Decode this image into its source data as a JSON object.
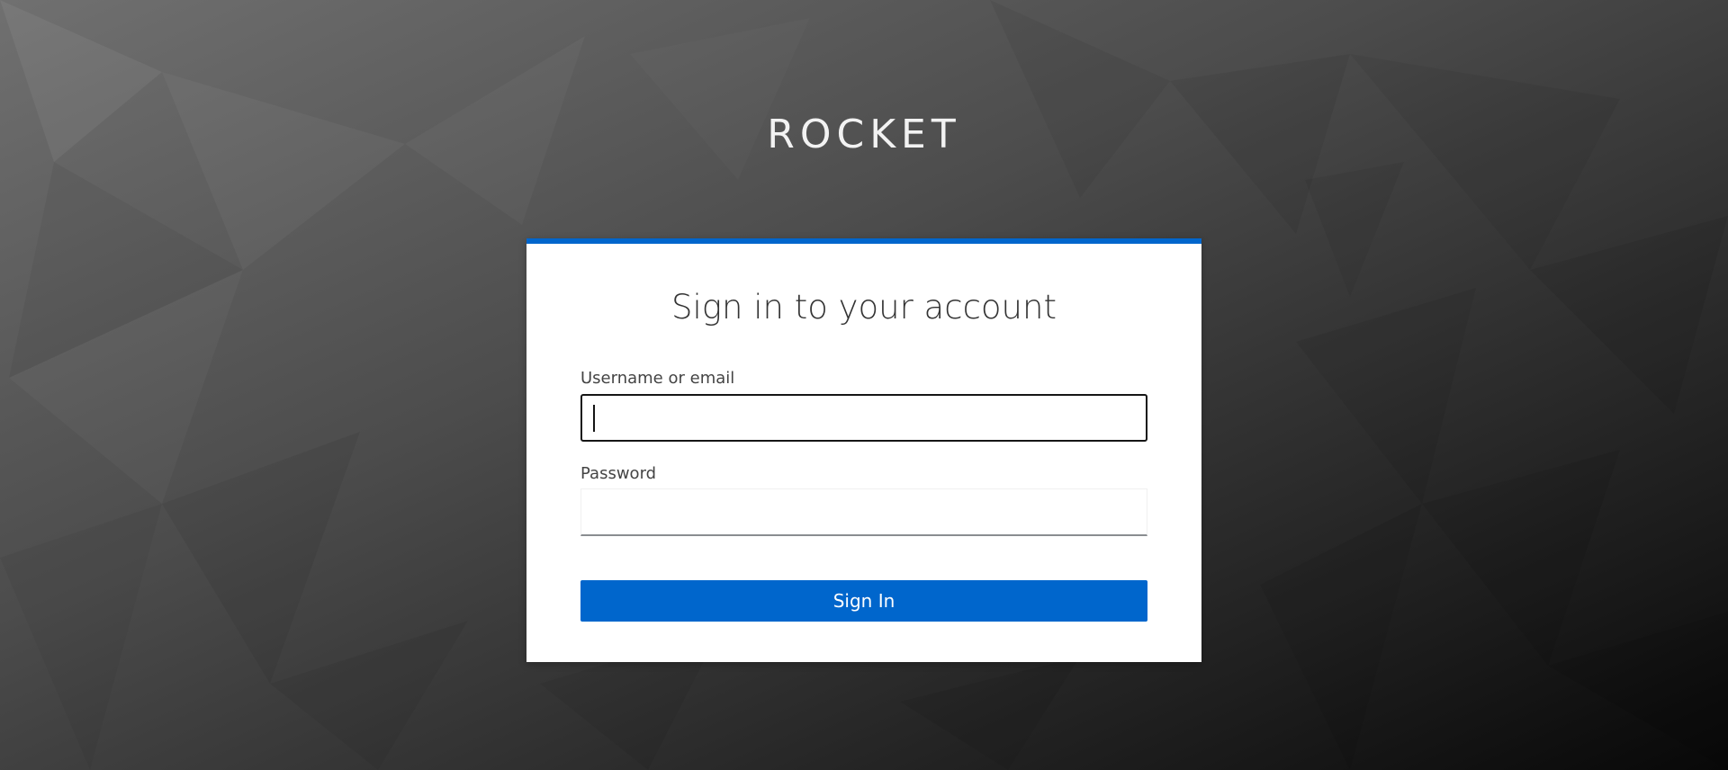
{
  "brand": {
    "name": "ROCKET"
  },
  "login": {
    "title": "Sign in to your account",
    "username_label": "Username or email",
    "username_value": "",
    "password_label": "Password",
    "password_value": "",
    "submit_label": "Sign In"
  },
  "colors": {
    "accent": "#0066cc",
    "card_background": "#ffffff",
    "text_primary": "#333333",
    "brand_text": "#f2f2f2"
  }
}
